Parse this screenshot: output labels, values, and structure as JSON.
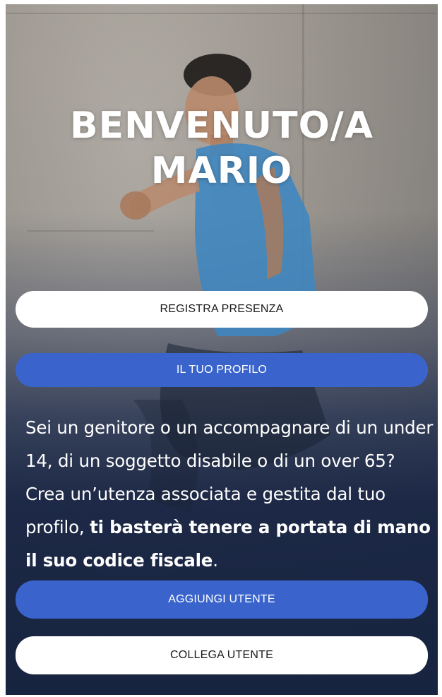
{
  "welcome": {
    "line1": "BENVENUTO/A",
    "line2": "MARIO"
  },
  "buttons": {
    "registra_presenza": "REGISTRA PRESENZA",
    "il_tuo_profilo": "IL TUO PROFILO",
    "aggiungi_utente": "AGGIUNGI UTENTE",
    "collega_utente": "COLLEGA UTENTE"
  },
  "info": {
    "text_regular": "Sei un genitore o un accompagnare di un under 14, di un soggetto disabile o di un over 65? Crea un’utenza associata e gestita dal tuo profilo, ",
    "text_bold": "ti basterà tenere a portata di mano il suo codice fiscale",
    "text_end": "."
  },
  "colors": {
    "accent_blue": "#3a64cc",
    "background_dark": "#17243f",
    "button_white": "#ffffff"
  },
  "background_image": "runner-on-concrete-wall"
}
